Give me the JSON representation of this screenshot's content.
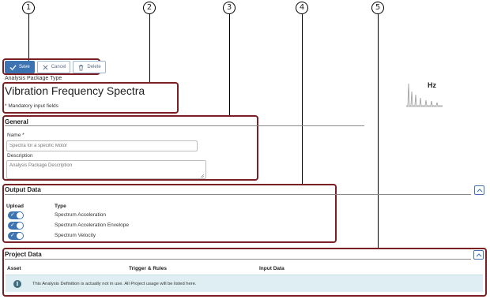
{
  "callouts": [
    "1",
    "2",
    "3",
    "4",
    "5"
  ],
  "toolbar": {
    "save_label": "Save",
    "cancel_label": "Cancel",
    "delete_label": "Delete"
  },
  "header": {
    "package_type_label": "Analysis Package Type",
    "title": "Vibration Frequency Spectra",
    "mandatory_note": "* Mandatory input fields",
    "preview_unit": "Hz"
  },
  "general": {
    "title": "General",
    "name_label": "Name *",
    "name_placeholder": "Spectra for a specific Motor",
    "description_label": "Description",
    "description_placeholder": "Analysis Package Description"
  },
  "output_data": {
    "title": "Output Data",
    "columns": {
      "upload": "Upload",
      "type": "Type"
    },
    "rows": [
      {
        "upload": true,
        "type": "Spectrum Acceleration"
      },
      {
        "upload": true,
        "type": "Spectrum Acceleration Envelope"
      },
      {
        "upload": true,
        "type": "Spectrum Velocity"
      }
    ]
  },
  "project_data": {
    "title": "Project Data",
    "columns": {
      "asset": "Asset",
      "trigger_rules": "Trigger & Rules",
      "input_data": "Input Data"
    },
    "info_message": "This Analysis Definition is actually not in use. All Project usage will be listed here."
  },
  "colors": {
    "accent": "#3d73b0",
    "annotation_border": "#7a1f24",
    "info_background": "#dfeef2"
  },
  "icons": {
    "save": "check-icon",
    "cancel": "close-icon",
    "delete": "trash-icon",
    "collapse": "chevron-up-icon",
    "info": "info-icon"
  }
}
